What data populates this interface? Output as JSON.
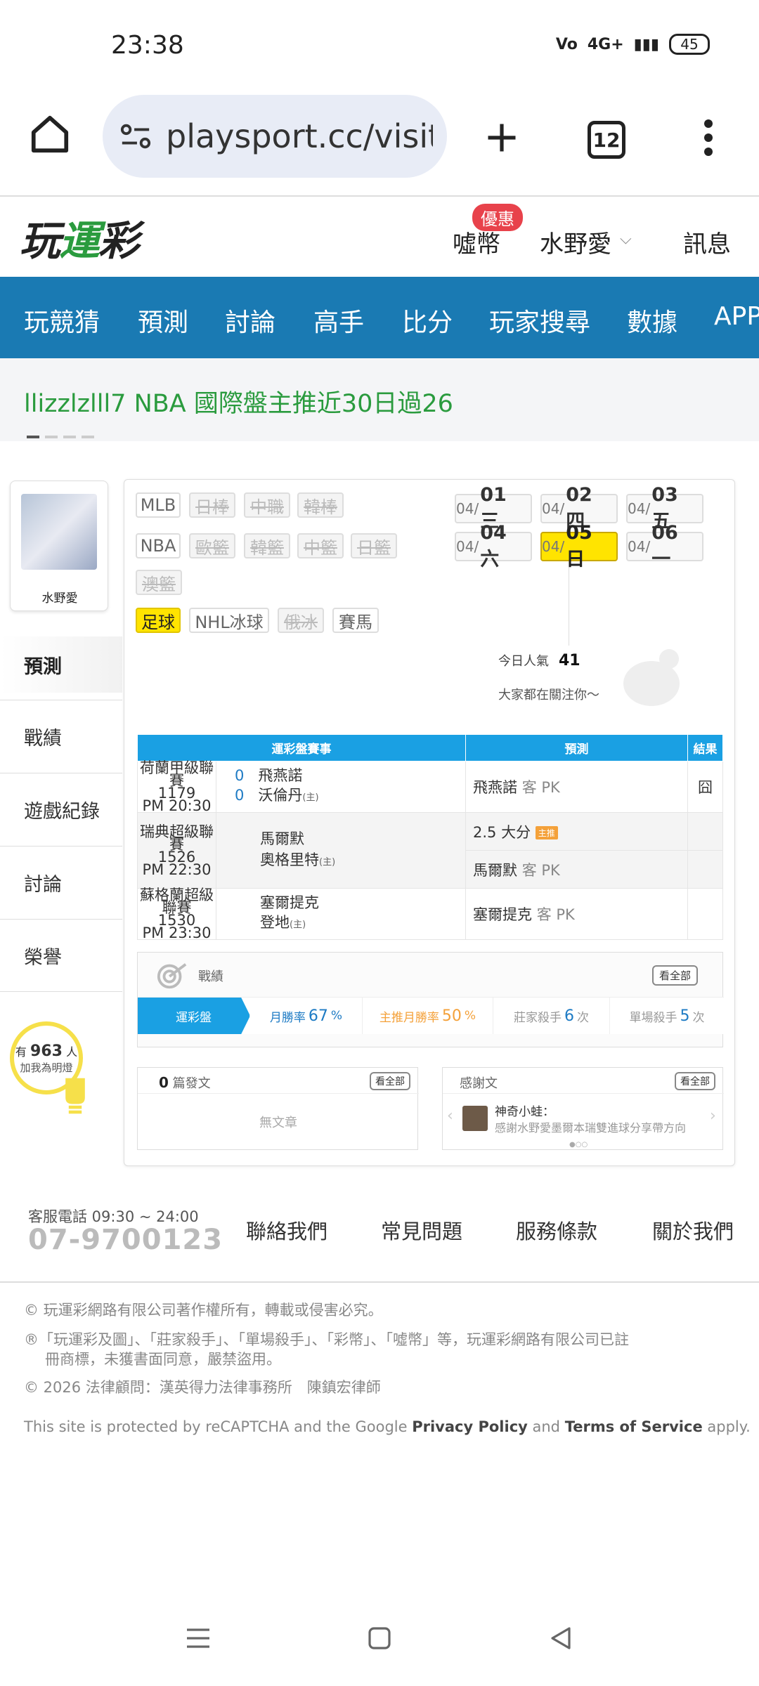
{
  "status": {
    "time": "23:38",
    "network": "4G+",
    "battery": "45"
  },
  "browser": {
    "url": "playsport.cc/visit",
    "tabs": "12"
  },
  "site": {
    "logo": "玩運彩",
    "promo": "優惠",
    "coin": "噓幣",
    "user": "水野愛",
    "msg": "訊息"
  },
  "nav": [
    "玩競猜",
    "預測",
    "討論",
    "高手",
    "比分",
    "玩家搜尋",
    "數據",
    "APP"
  ],
  "banner": "llizzlzlll7 NBA 國際盤主推近30日過26",
  "profile": {
    "name": "水野愛"
  },
  "side_menu": [
    "預測",
    "戰績",
    "遊戲紀錄",
    "討論",
    "榮譽"
  ],
  "fans": {
    "pre": "有",
    "count": "963",
    "post": "人",
    "sub": "加我為明燈"
  },
  "sports": {
    "row1": [
      "MLB",
      "日棒",
      "中職",
      "韓棒"
    ],
    "row2": [
      "NBA",
      "歐籃",
      "韓籃",
      "中籃",
      "日籃"
    ],
    "row3": [
      "澳籃"
    ],
    "row4": [
      "足球",
      "NHL冰球",
      "俄冰",
      "賽馬"
    ]
  },
  "dates": [
    {
      "md": "04/",
      "d": "01 三"
    },
    {
      "md": "04/",
      "d": "02 四"
    },
    {
      "md": "04/",
      "d": "03 五"
    },
    {
      "md": "04/",
      "d": "04 六"
    },
    {
      "md": "04/",
      "d": "05 日"
    },
    {
      "md": "04/",
      "d": "06 一"
    }
  ],
  "popularity": {
    "label": "今日人氣",
    "value": "41",
    "sub": "大家都在關注你～"
  },
  "table": {
    "headers": [
      "運彩盤賽事",
      "預測",
      "結果"
    ],
    "g1": {
      "league": "荷蘭甲級聯賽",
      "no": "1179",
      "time": "PM 20:30",
      "s1": "0",
      "s2": "0",
      "t1": "飛燕諾",
      "t2": "沃倫丹",
      "home": "(主)",
      "pick": "飛燕諾",
      "pk": "客 PK",
      "result": "囧"
    },
    "g2": {
      "league": "瑞典超級聯賽",
      "no": "1526",
      "time": "PM 22:30",
      "t1": "馬爾默",
      "t2": "奧格里特",
      "home": "(主)",
      "pick1": "2.5 大分",
      "badge": "主推",
      "pick2": "馬爾默",
      "pk": "客 PK"
    },
    "g3": {
      "league": "蘇格蘭超級聯賽",
      "no": "1530",
      "time": "PM 23:30",
      "t1": "塞爾提克",
      "t2": "登地",
      "home": "(主)",
      "pick": "塞爾提克",
      "pk": "客 PK"
    }
  },
  "record": {
    "title": "戰績",
    "all": "看全部",
    "tag": "運彩盤",
    "win_label": "月勝率",
    "win": "67",
    "main_label": "主推月勝率",
    "main": "50",
    "pct": "%",
    "banker_label": "莊家殺手",
    "banker": "6",
    "single_label": "單場殺手",
    "single": "5",
    "times": "次"
  },
  "posts": {
    "count": "0",
    "label": "篇發文",
    "all": "看全部",
    "empty": "無文章"
  },
  "thanks": {
    "label": "感謝文",
    "all": "看全部",
    "user": "神奇小蛙：",
    "text": "感謝水野愛墨爾本瑞雙進球分享帶方向"
  },
  "footer": {
    "tel_label": "客服電話 09:30 ~ 24:00",
    "tel": "07-9700123",
    "links": [
      "聯絡我們",
      "常見問題",
      "服務條款",
      "關於我們"
    ],
    "copy1": "© 玩運彩網路有限公司著作權所有，轉載或侵害必究。",
    "copy2a": "®「玩運彩及圖」、「莊家殺手」、「單場殺手」、「彩幣」、「噓幣」等，玩運彩網路有限公司已註",
    "copy2b": "冊商標，未獲書面同意，嚴禁盜用。",
    "copy3": "© 2026 法律顧問：漢英得力法律事務所　陳鎮宏律師",
    "captcha_a": "This site is protected by reCAPTCHA and the Google ",
    "pp": "Privacy Policy",
    "and": " and ",
    "tos": "Terms of Service",
    "apply": " apply."
  }
}
